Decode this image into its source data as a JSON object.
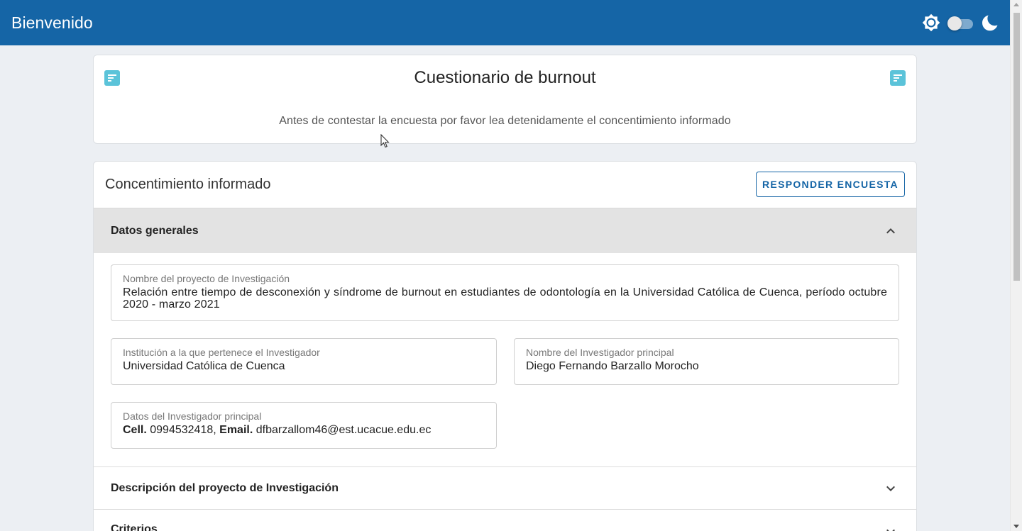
{
  "header": {
    "title": "Bienvenido",
    "theme_toggle_on": false,
    "colors": {
      "bar": "#1565a6",
      "accent_icon": "#5bc3d9"
    }
  },
  "survey": {
    "title": "Cuestionario de burnout",
    "subtitle": "Antes de contestar la encuesta por favor lea detenidamente el concentimiento informado"
  },
  "consent": {
    "title": "Concentimiento informado",
    "respond_button": "RESPONDER ENCUESTA",
    "sections": [
      {
        "label": "Datos generales",
        "expanded": true
      },
      {
        "label": "Descripción del proyecto de Investigación",
        "expanded": false
      },
      {
        "label": "Criterios",
        "expanded": false
      }
    ],
    "general": {
      "project_label": "Nombre del proyecto de Investigación",
      "project_value": "Relación entre tiempo de desconexión y síndrome de burnout en estudiantes de odontología en la Universidad Católica de Cuenca, período octubre 2020 - marzo 2021",
      "institution_label": "Institución a la que pertenece el Investigador",
      "institution_value": "Universidad Católica de Cuenca",
      "researcher_label": "Nombre del Investigador principal",
      "researcher_value": "Diego Fernando Barzallo Morocho",
      "contact_label": "Datos del Investigador principal",
      "cell_label": "Cell.",
      "cell_value": "0994532418,",
      "email_label": "Email.",
      "email_value": "dfbarzallom46@est.ucacue.edu.ec"
    }
  }
}
